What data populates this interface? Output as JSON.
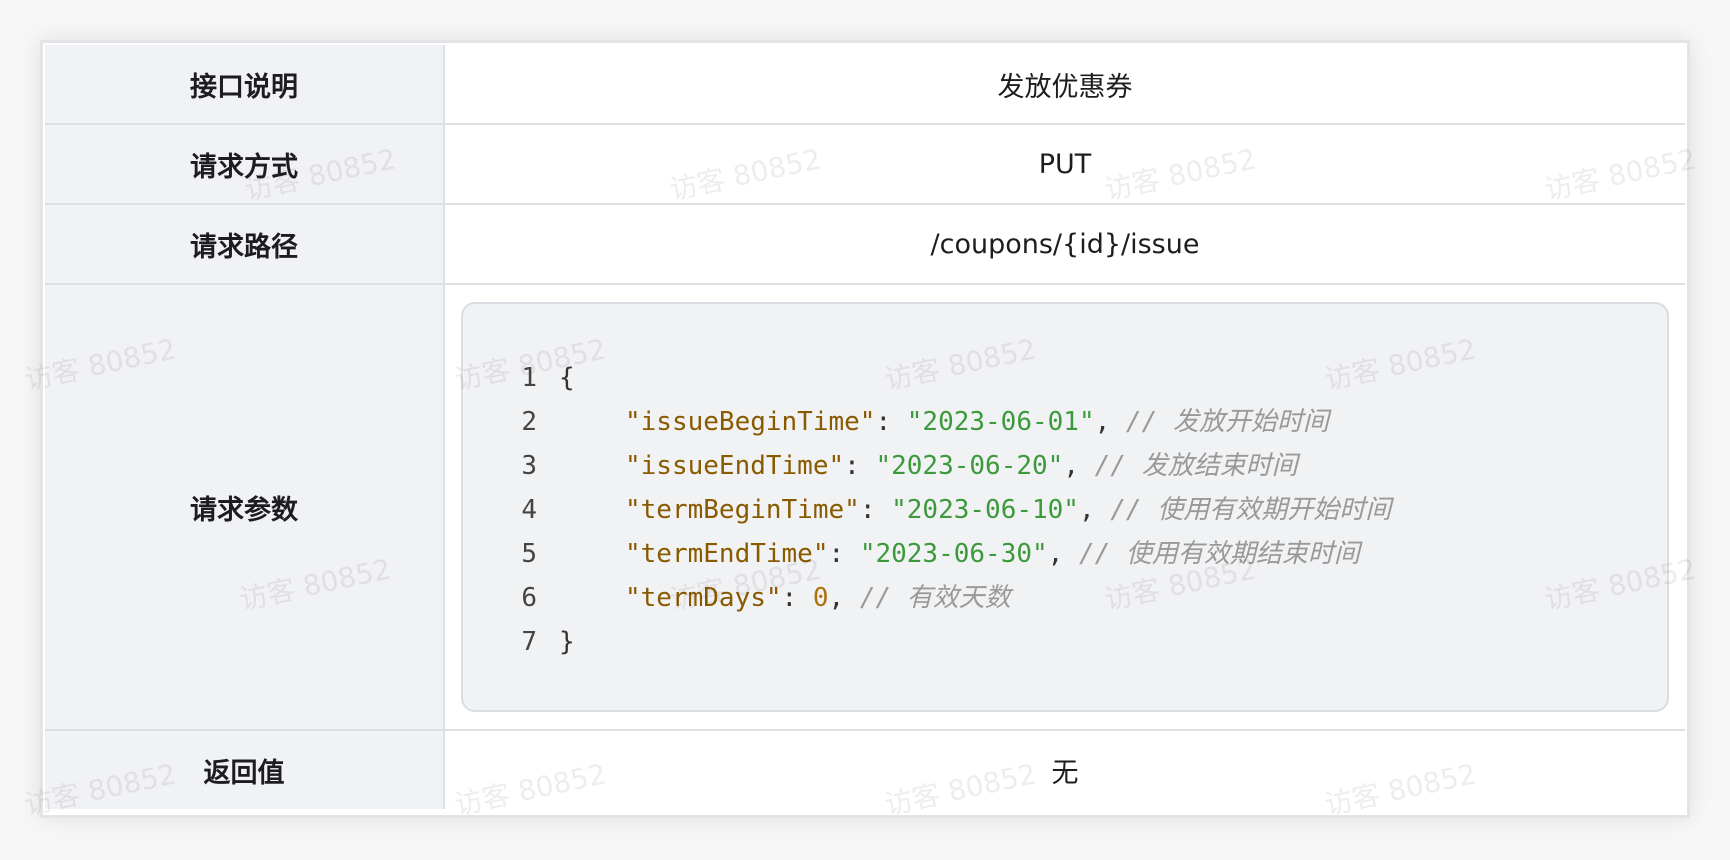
{
  "table": {
    "rows": [
      {
        "label": "接口说明",
        "value": "发放优惠券"
      },
      {
        "label": "请求方式",
        "value": "PUT"
      },
      {
        "label": "请求路径",
        "value": "/coupons/{id}/issue"
      },
      {
        "label": "请求参数",
        "value": ""
      },
      {
        "label": "返回值",
        "value": "无"
      }
    ]
  },
  "code": {
    "lines": [
      {
        "num": "1",
        "open": "{"
      },
      {
        "num": "2",
        "key": "\"issueBeginTime\"",
        "sep": ": ",
        "val": "\"2023-06-01\"",
        "comma": ", ",
        "comment": "// 发放开始时间"
      },
      {
        "num": "3",
        "key": "\"issueEndTime\"",
        "sep": ": ",
        "val": "\"2023-06-20\"",
        "comma": ", ",
        "comment": "// 发放结束时间"
      },
      {
        "num": "4",
        "key": "\"termBeginTime\"",
        "sep": ": ",
        "val": "\"2023-06-10\"",
        "comma": ", ",
        "comment": "// 使用有效期开始时间"
      },
      {
        "num": "5",
        "key": "\"termEndTime\"",
        "sep": ": ",
        "val": "\"2023-06-30\"",
        "comma": ", ",
        "comment": "// 使用有效期结束时间"
      },
      {
        "num": "6",
        "key": "\"termDays\"",
        "sep": ": ",
        "num_val": "0",
        "comma": ", ",
        "comment": "// 有效天数"
      },
      {
        "num": "7",
        "close": "}"
      }
    ]
  },
  "watermark": {
    "text": "访客 80852"
  },
  "colors": {
    "label_bg": "#f1f2f4",
    "border": "#dcdfe4",
    "key": "#8a5a00",
    "string": "#3c9a3c",
    "number": "#b0700a",
    "comment": "#999999"
  }
}
